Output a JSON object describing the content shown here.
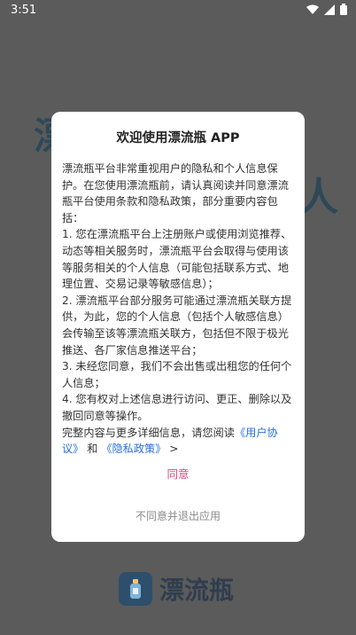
{
  "status_bar": {
    "time": "3:51"
  },
  "background": {
    "left_text": "漂",
    "right_text": "人"
  },
  "dialog": {
    "title": "欢迎使用漂流瓶 APP",
    "intro": "漂流瓶平台非常重视用户的隐私和个人信息保护。在您使用漂流瓶前，请认真阅读并同意漂流瓶平台使用条款和隐私政策，部分重要内容包括：",
    "items": [
      "1. 您在漂流瓶平台上注册账户或使用浏览推荐、动态等相关服务时，漂流瓶平台会取得与使用该等服务相关的个人信息（可能包括联系方式、地理位置、交易记录等敏感信息）；",
      "2. 漂流瓶平台部分服务可能通过漂流瓶关联方提供，为此，您的个人信息（包括个人敏感信息）会传输至该等漂流瓶关联方，包括但不限于极光推送、各厂家信息推送平台；",
      "3. 未经您同意，我们不会出售或出租您的任何个人信息；",
      "4. 您有权对上述信息进行访问、更正、删除以及撤回同意等操作。"
    ],
    "closing_prefix": "完整内容与更多详细信息，请您阅读",
    "user_agreement_link": "《用户协议》",
    "and_text": " 和 ",
    "privacy_link": "《隐私政策》",
    "closing_suffix": " >",
    "agree_label": "同意",
    "disagree_label": "不同意并退出应用"
  },
  "brand": {
    "name": "漂流瓶"
  },
  "colors": {
    "accent": "#e0457b",
    "link": "#2a6fdb",
    "brand": "#2d4f6b"
  },
  "icons": [
    "wifi-icon",
    "signal-icon",
    "battery-icon",
    "bottle-logo-icon"
  ]
}
